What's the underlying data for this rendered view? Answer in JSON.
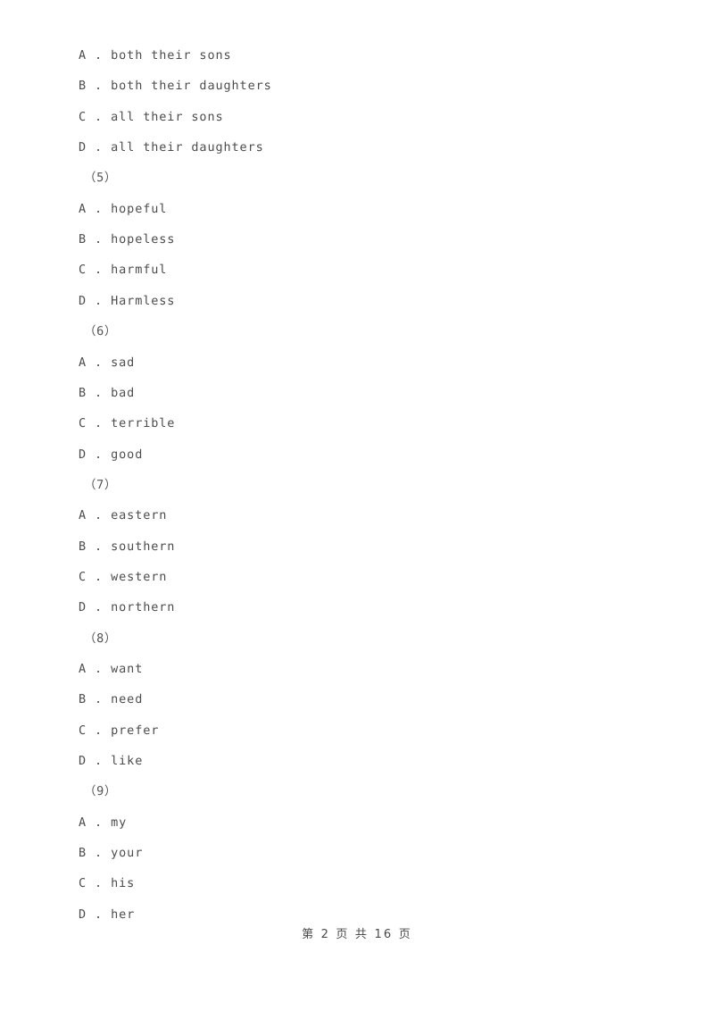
{
  "document": {
    "page_background": "#ffffff",
    "text_color": "#4a4a4a"
  },
  "blocks": [
    {
      "question_number": "",
      "options": [
        "A . both their sons",
        "B . both their daughters",
        "C . all their sons",
        "D . all their daughters"
      ]
    },
    {
      "question_number": "（5）",
      "options": [
        "A . hopeful",
        "B . hopeless",
        "C . harmful",
        "D . Harmless"
      ]
    },
    {
      "question_number": "（6）",
      "options": [
        "A . sad",
        "B . bad",
        "C . terrible",
        "D . good"
      ]
    },
    {
      "question_number": "（7）",
      "options": [
        "A . eastern",
        "B . southern",
        "C . western",
        "D . northern"
      ]
    },
    {
      "question_number": "（8）",
      "options": [
        "A . want",
        "B . need",
        "C . prefer",
        "D . like"
      ]
    },
    {
      "question_number": "（9）",
      "options": [
        "A . my",
        "B . your",
        "C . his",
        "D . her"
      ]
    }
  ],
  "footer": {
    "text": "第 2 页 共 16 页",
    "current_page": "2",
    "total_pages": "16"
  }
}
